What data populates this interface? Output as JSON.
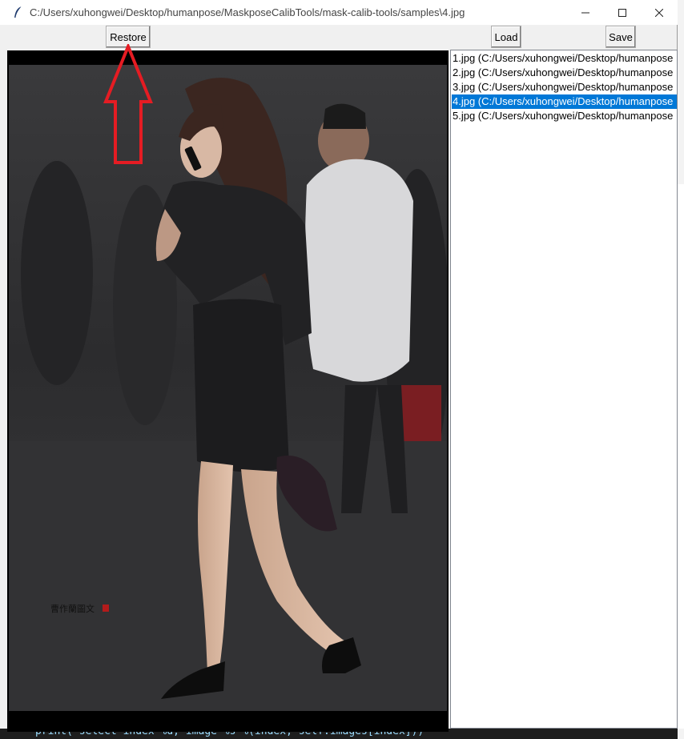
{
  "window": {
    "title": "C:/Users/xuhongwei/Desktop/humanpose/MaskposeCalibTools/mask-calib-tools/samples\\4.jpg"
  },
  "toolbar": {
    "restore_label": "Restore",
    "load_label": "Load",
    "save_label": "Save"
  },
  "listbox": {
    "items": [
      {
        "label": "1.jpg (C:/Users/xuhongwei/Desktop/humanpose"
      },
      {
        "label": "2.jpg (C:/Users/xuhongwei/Desktop/humanpose"
      },
      {
        "label": "3.jpg (C:/Users/xuhongwei/Desktop/humanpose"
      },
      {
        "label": "4.jpg (C:/Users/xuhongwei/Desktop/humanpose",
        "selected": true
      },
      {
        "label": "5.jpg (C:/Users/xuhongwei/Desktop/humanpose"
      }
    ]
  },
  "canvas": {
    "watermark_text": "曹作蘭圖文"
  },
  "background_editor": {
    "code_line": "print('select index %d, image %s'%(index, self.images[index]))"
  },
  "colors": {
    "selection": "#0078d7",
    "annotation_arrow": "#e51c23",
    "canvas_background": "#000000"
  },
  "icons": {
    "app": "feather-icon",
    "minimize": "minimize-icon",
    "maximize": "maximize-icon",
    "close": "close-icon"
  }
}
